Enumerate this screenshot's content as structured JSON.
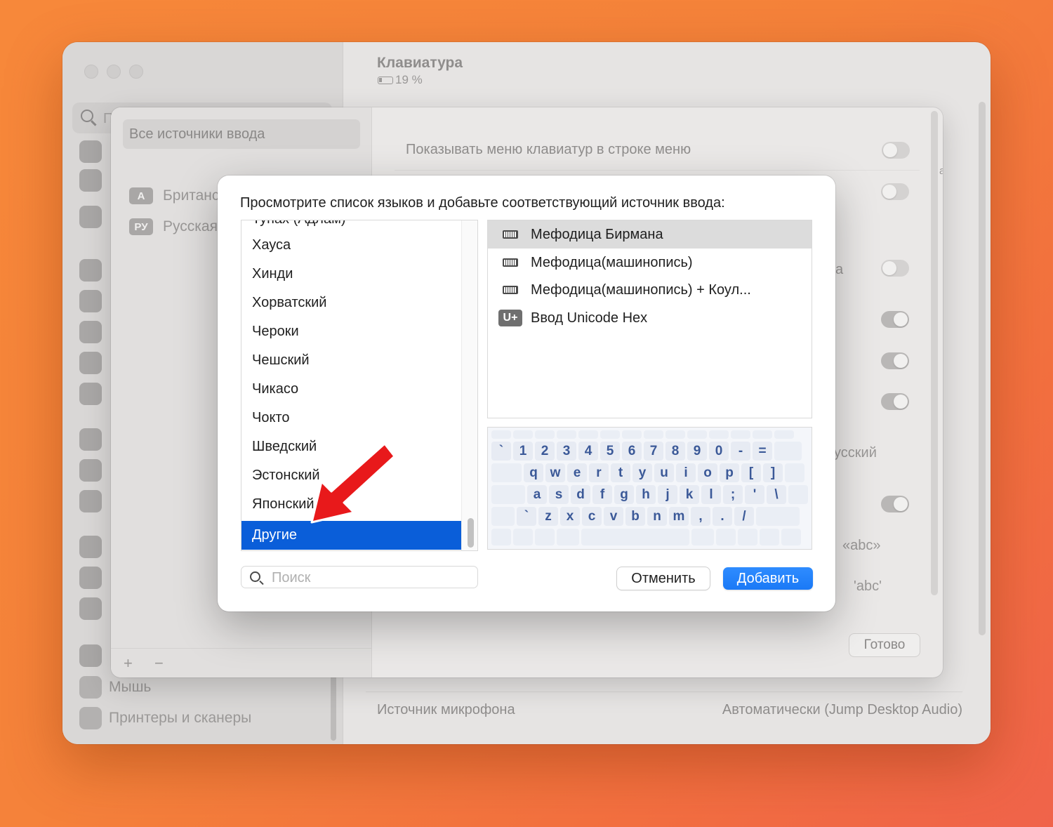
{
  "window": {
    "title": "Клавиатура",
    "battery": "19 %",
    "sidebar_search_placeholder": "П",
    "sidebar_items": [
      {
        "label": "Мышь"
      },
      {
        "label": "Принтеры и сканеры"
      }
    ],
    "mic_label": "Источник микрофона",
    "mic_value": "Автоматически (Jump Desktop Audio)"
  },
  "sheet": {
    "all_sources": "Все источники ввода",
    "sources": [
      {
        "badge": "A",
        "label": "Британс"
      },
      {
        "badge": "РУ",
        "label": "Русская"
      }
    ],
    "show_menu_label": "Показывать меню клавиатур в строке меню",
    "side_texts": [
      "ая",
      "а",
      "усский",
      "«abc»",
      "'abc'"
    ],
    "add": "+",
    "remove": "−",
    "done": "Готово"
  },
  "dialog": {
    "title": "Просмотрите список языков и добавьте соответствующий источник ввода:",
    "languages_partial": "Тупах (Адлам)",
    "languages": [
      "Хауса",
      "Хинди",
      "Хорватский",
      "Чероки",
      "Чешский",
      "Чикасо",
      "Чокто",
      "Шведский",
      "Эстонский",
      "Японский",
      "Другие"
    ],
    "selected_language": "Другие",
    "methods": [
      {
        "icon": "keyboard-icon",
        "label": "Мефодица Бирмана",
        "selected": true
      },
      {
        "icon": "keyboard-icon",
        "label": "Мефодица(машинопись)",
        "selected": false
      },
      {
        "icon": "keyboard-icon",
        "label": "Мефодица(машинопись) + Коул...",
        "selected": false
      },
      {
        "icon": "unicode-icon",
        "badge": "U+",
        "label": "Ввод Unicode Hex",
        "selected": false
      }
    ],
    "keyboard_rows": [
      [
        "`",
        "1",
        "2",
        "3",
        "4",
        "5",
        "6",
        "7",
        "8",
        "9",
        "0",
        "-",
        "="
      ],
      [
        "q",
        "w",
        "e",
        "r",
        "t",
        "y",
        "u",
        "i",
        "o",
        "p",
        "[",
        "]"
      ],
      [
        "a",
        "s",
        "d",
        "f",
        "g",
        "h",
        "j",
        "k",
        "l",
        ";",
        "'",
        "\\"
      ],
      [
        "`",
        "z",
        "x",
        "c",
        "v",
        "b",
        "n",
        "m",
        ",",
        ".",
        "/"
      ]
    ],
    "search_placeholder": "Поиск",
    "cancel": "Отменить",
    "add": "Добавить"
  },
  "colors": {
    "accent": "#0a5ed9",
    "button_blue": "#1a79f6",
    "arrow": "#e8191b",
    "key_text": "#3b5998"
  }
}
